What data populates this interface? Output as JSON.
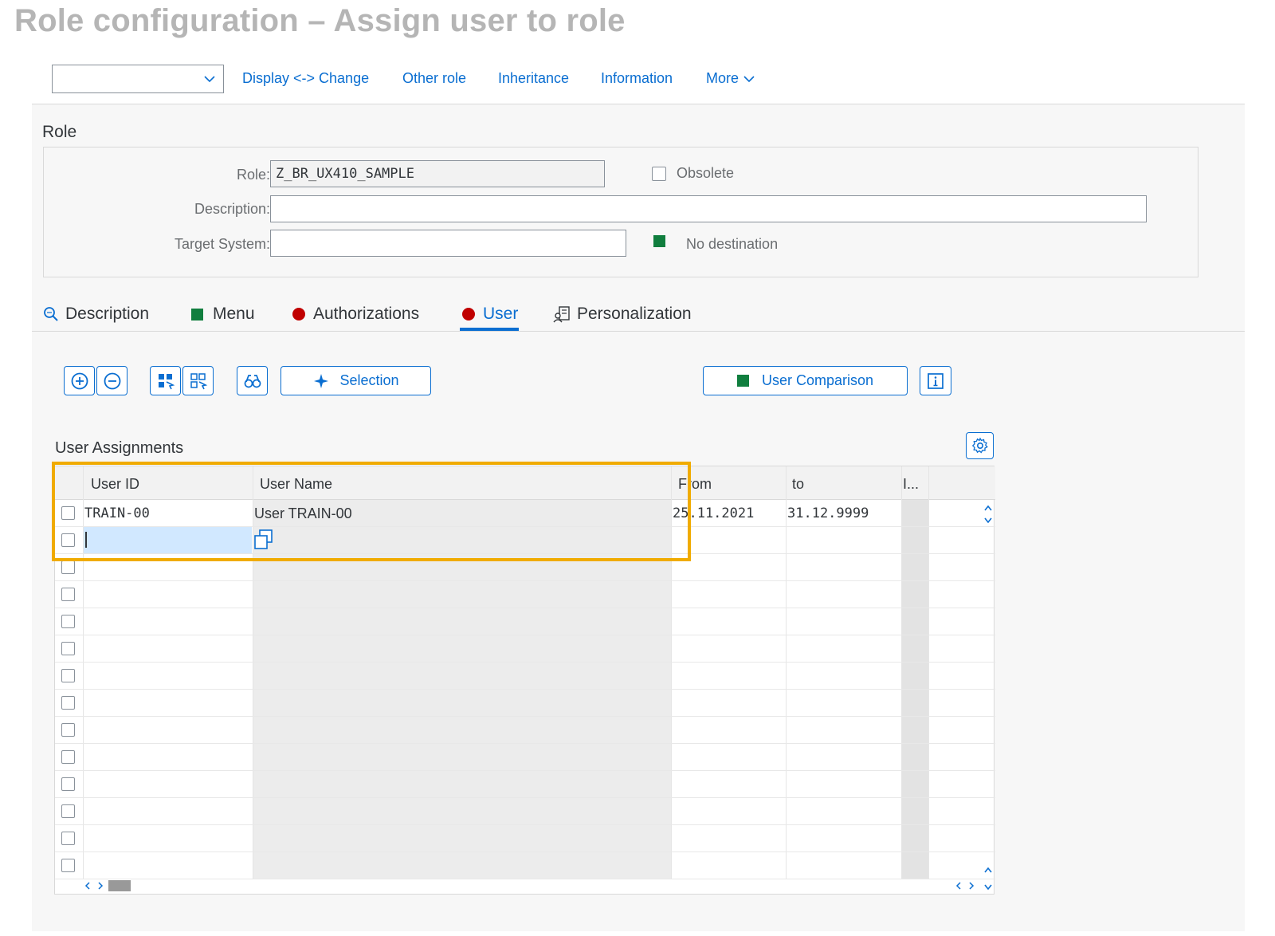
{
  "page_title": "Role configuration – Assign user to role",
  "toolbar": {
    "select_value": "",
    "links": [
      "Display <-> Change",
      "Other role",
      "Inheritance",
      "Information",
      "More"
    ]
  },
  "role_section": {
    "title": "Role",
    "role_label": "Role:",
    "role_value": "Z_BR_UX410_SAMPLE",
    "obsolete_label": "Obsolete",
    "description_label": "Description:",
    "description_value": "",
    "target_system_label": "Target System:",
    "target_system_value": "",
    "destination_status": "No destination"
  },
  "tabs": [
    {
      "label": "Description",
      "icon": "search-magnifier-icon"
    },
    {
      "label": "Menu",
      "icon": "green-status-square"
    },
    {
      "label": "Authorizations",
      "icon": "red-status-dot"
    },
    {
      "label": "User",
      "icon": "red-status-dot",
      "active": true
    },
    {
      "label": "Personalization",
      "icon": "personalization-icon"
    }
  ],
  "actions": {
    "selection_label": "Selection",
    "user_comparison_label": "User Comparison"
  },
  "table": {
    "title": "User Assignments",
    "columns": [
      "User ID",
      "User Name",
      "From",
      "to",
      "I..."
    ],
    "rows": [
      {
        "user_id": "TRAIN-00",
        "user_name": "User TRAIN-00",
        "from": "25.11.2021",
        "to": "31.12.9999"
      },
      {
        "user_id": "",
        "user_name": "",
        "from": "",
        "to": ""
      }
    ],
    "empty_rows": 12
  },
  "colors": {
    "accent": "#0a6ed1",
    "status_green": "#107e3e",
    "status_red": "#c00000",
    "highlight": "#f0ab00"
  }
}
